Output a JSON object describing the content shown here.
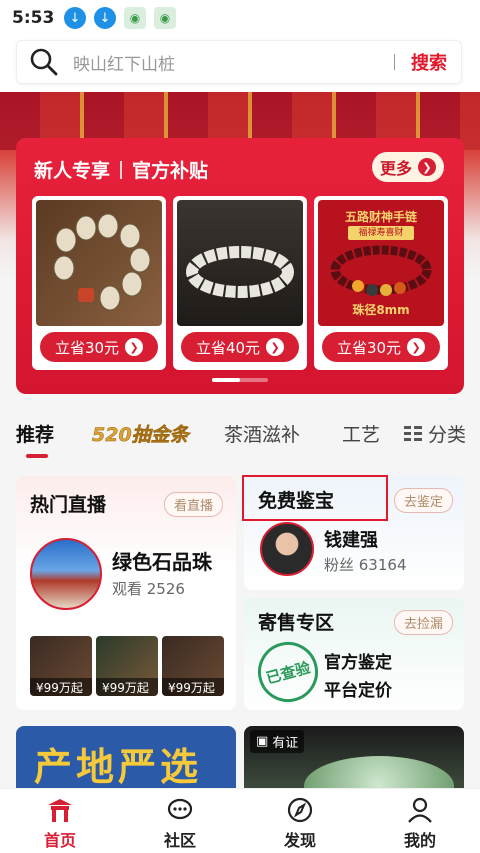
{
  "status_bar": {
    "time": "5:53"
  },
  "search": {
    "placeholder": "映山红下山桩",
    "button_label": "搜索"
  },
  "promo": {
    "title_left": "新人专享",
    "title_right": "官方补贴",
    "more_label": "更多",
    "products": [
      {
        "button_label": "立省30元"
      },
      {
        "button_label": "立省40元"
      },
      {
        "button_label": "立省30元",
        "image_text_top": "五路财神手链",
        "image_text_sub": "福禄寿喜财",
        "image_text_bottom": "珠径8mm"
      }
    ]
  },
  "tabs": [
    {
      "label": "推荐",
      "active": true
    },
    {
      "label": "520抽金条"
    },
    {
      "label": "茶酒滋补"
    },
    {
      "label": "工艺"
    }
  ],
  "category_label": "分类",
  "live": {
    "title": "热门直播",
    "tag": "看直播",
    "room_name": "绿色石品珠",
    "viewers": "观看 2526",
    "thumbs": [
      {
        "price": "¥99万起"
      },
      {
        "price": "¥99万起"
      },
      {
        "price": "¥99万起"
      }
    ]
  },
  "appraisal": {
    "title": "免费鉴宝",
    "tag": "去鉴定",
    "expert_name": "钱建强",
    "fans": "粉丝 63164"
  },
  "consign": {
    "title": "寄售专区",
    "tag": "去捡漏",
    "stamp": "已查验",
    "line1": "官方鉴定",
    "line2": "平台定价"
  },
  "bottom_cards": {
    "left_text": "产地严选",
    "right_badge": "有证"
  },
  "nav": [
    {
      "label": "首页",
      "active": true
    },
    {
      "label": "社区"
    },
    {
      "label": "发现"
    },
    {
      "label": "我的"
    }
  ],
  "colors": {
    "accent": "#d81e33",
    "gold": "#d9a236"
  }
}
